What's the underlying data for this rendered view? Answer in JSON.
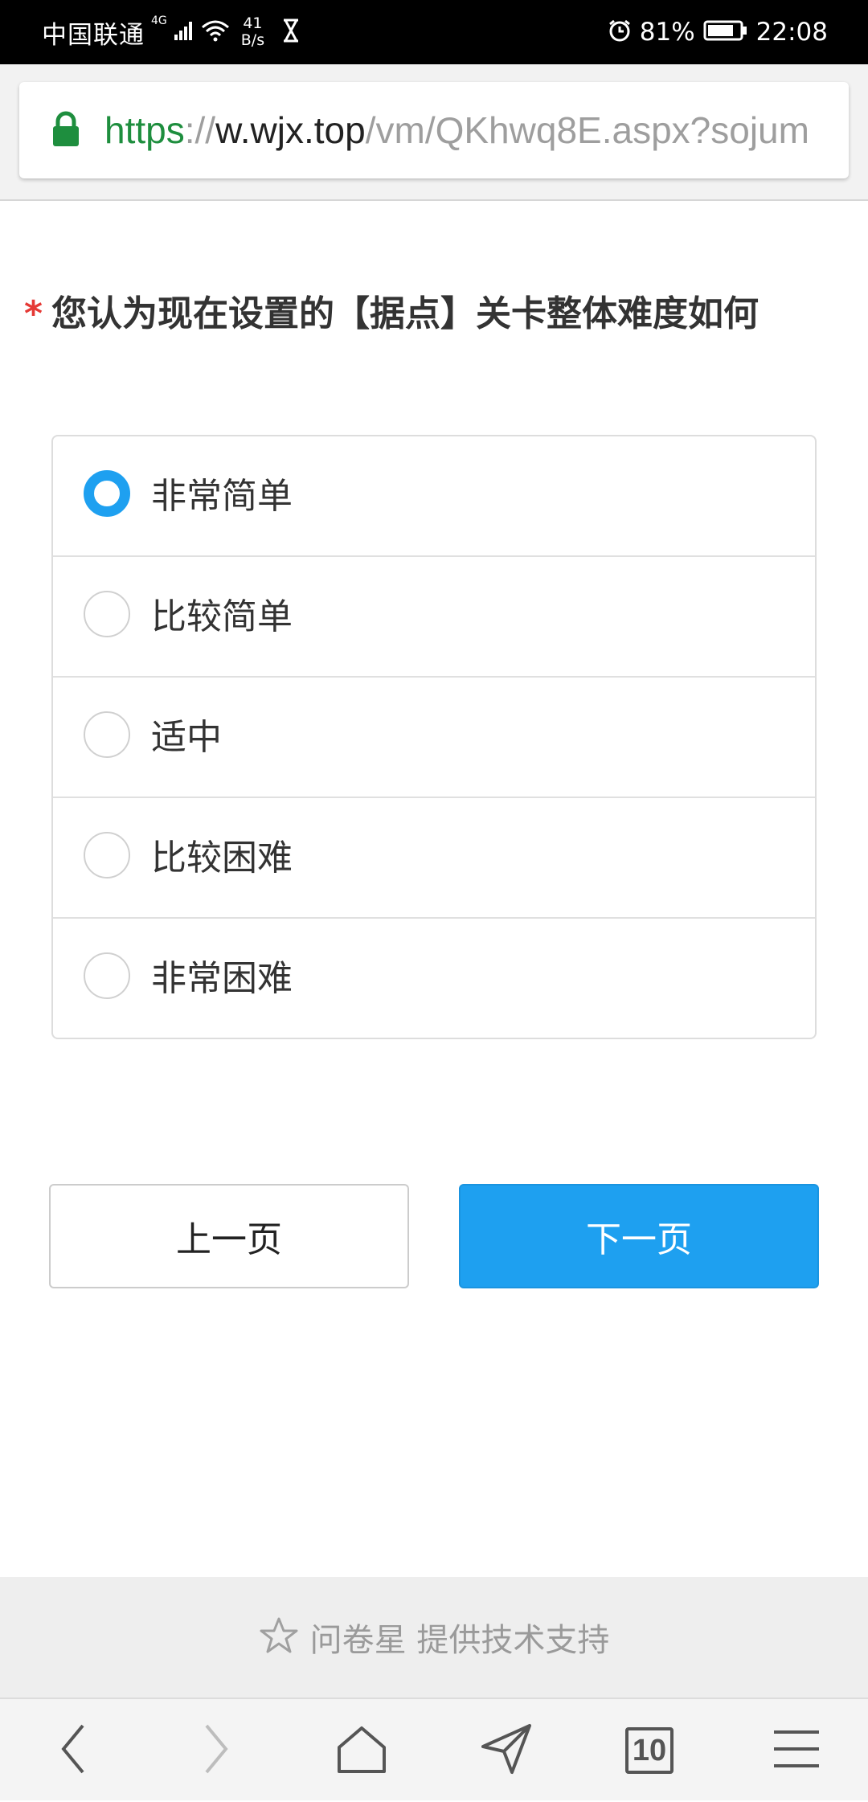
{
  "status_bar": {
    "carrier": "中国联通",
    "network": "4G",
    "speed_value": "41",
    "speed_unit": "B/s",
    "battery": "81%",
    "time": "22:08"
  },
  "browser": {
    "url_scheme": "https",
    "url_sep": "://",
    "url_host": "w.wjx.top",
    "url_path": "/vm/QKhwq8E.aspx?sojum",
    "tab_count": "10"
  },
  "question": {
    "required_mark": "*",
    "text": "您认为现在设置的【据点】关卡整体难度如何"
  },
  "options": [
    {
      "label": "非常简单",
      "selected": true
    },
    {
      "label": "比较简单",
      "selected": false
    },
    {
      "label": "适中",
      "selected": false
    },
    {
      "label": "比较困难",
      "selected": false
    },
    {
      "label": "非常困难",
      "selected": false
    }
  ],
  "buttons": {
    "prev": "上一页",
    "next": "下一页"
  },
  "footer": {
    "text": "问卷星 提供技术支持"
  },
  "colors": {
    "accent": "#1ea0f0",
    "required": "#e53935",
    "secure": "#1e8e3e"
  }
}
